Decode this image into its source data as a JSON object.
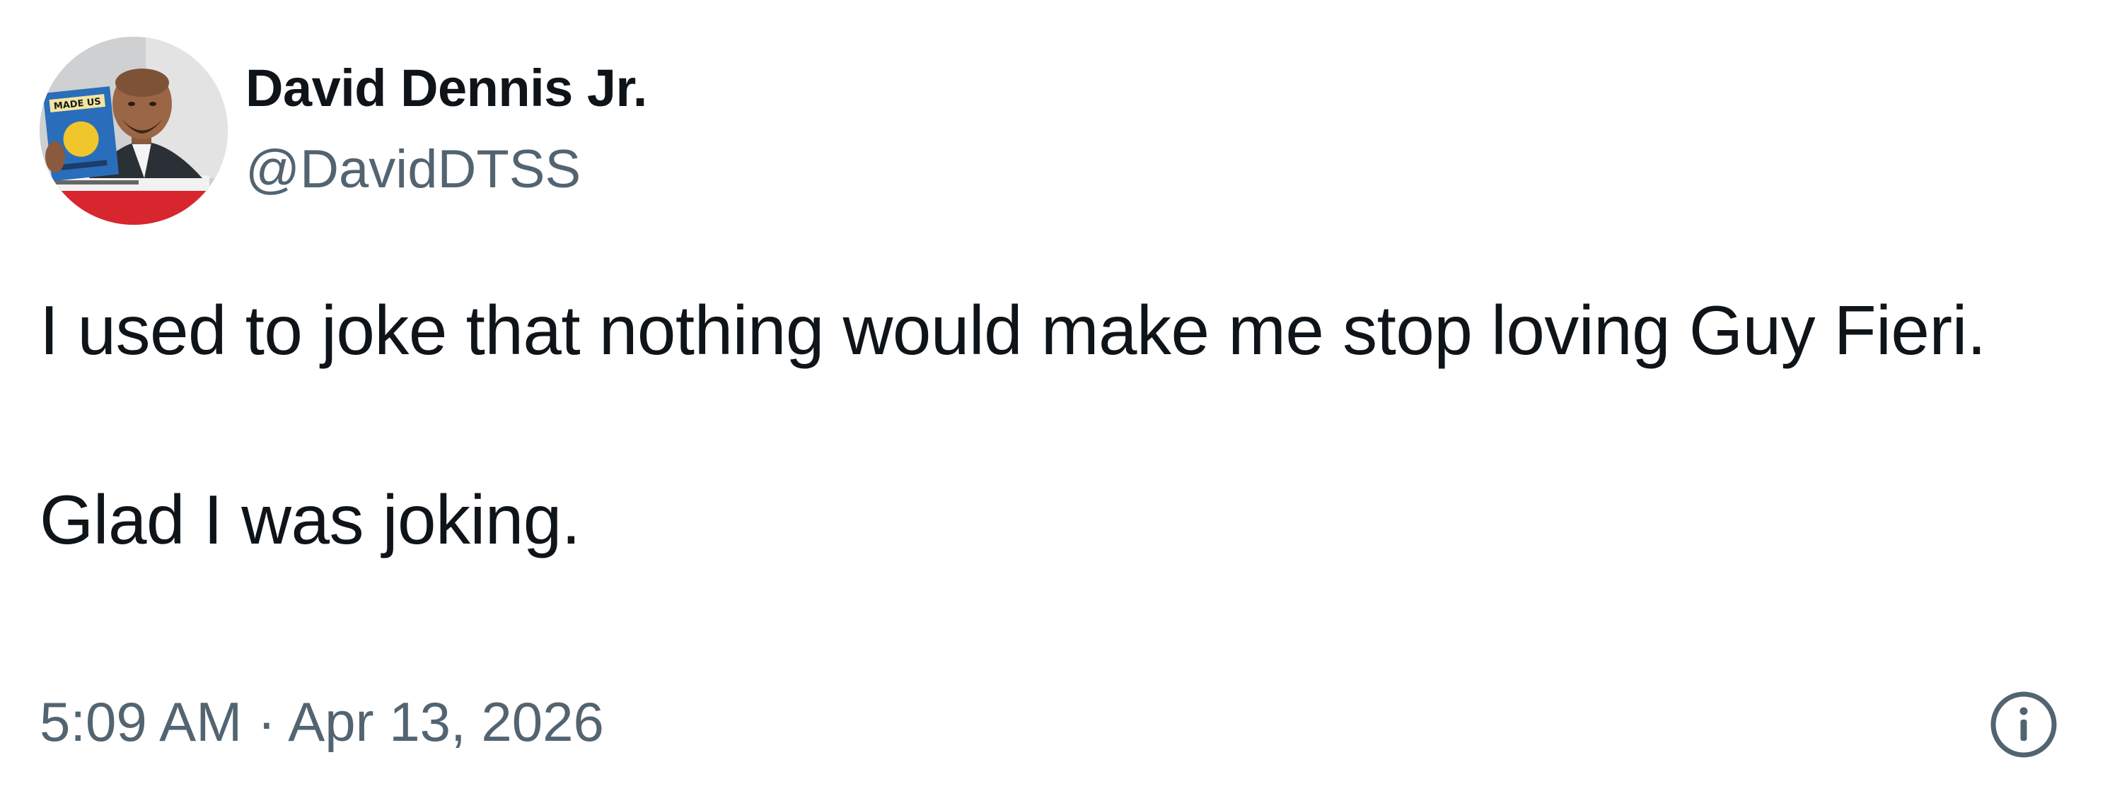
{
  "author": {
    "display_name": "David Dennis Jr.",
    "handle": "@DavidDTSS"
  },
  "tweet": {
    "paragraphs": [
      "I used to joke that nothing would make me stop loving Guy Fieri.",
      "Glad I was joking."
    ],
    "timestamp": "5:09 AM · Apr 13, 2026"
  },
  "avatar_image": {
    "lettering": "MADE US"
  },
  "icons": {
    "info": "info-icon"
  },
  "colors": {
    "text_primary": "#0f1419",
    "text_secondary": "#536471",
    "background": "#ffffff"
  }
}
